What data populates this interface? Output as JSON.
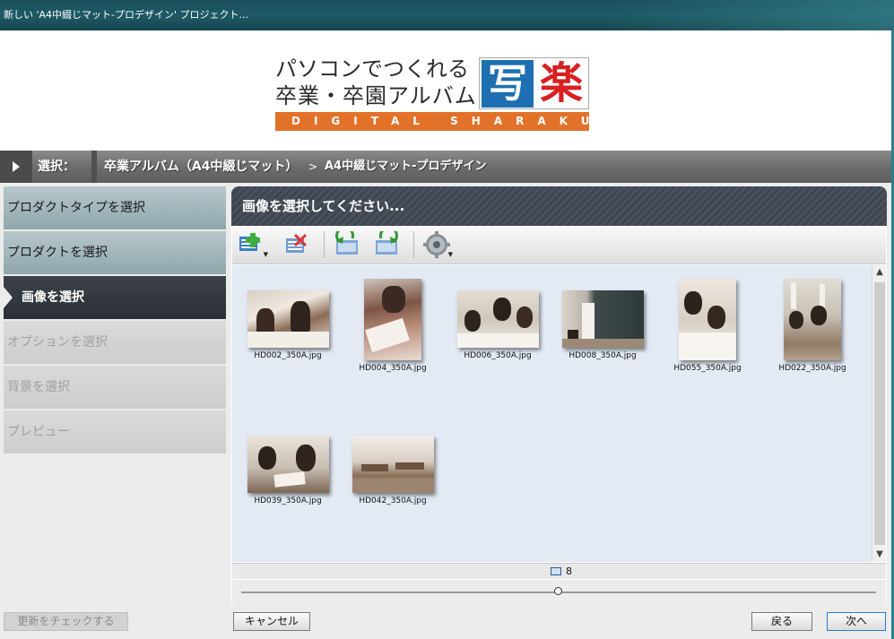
{
  "window": {
    "title": "新しい 'A4中綴じマット-プロデザイン' プロジェクト..."
  },
  "logo": {
    "line1": "パソコンでつくれる",
    "line2": "卒業・卒園アルバム",
    "stripe": "DIGITAL SHARAKU",
    "mark_left": "写",
    "mark_right": "楽"
  },
  "breadcrumb": {
    "label": "選択：",
    "item1": "卒業アルバム（A4中綴じマット）",
    "separator": ">",
    "item2": "A4中綴じマット-プロデザイン"
  },
  "steps": [
    {
      "label": "プロダクトタイプを選択",
      "state": "done"
    },
    {
      "label": "プロダクトを選択",
      "state": "done"
    },
    {
      "label": "画像を選択",
      "state": "current"
    },
    {
      "label": "オプションを選択",
      "state": "todo"
    },
    {
      "label": "背景を選択",
      "state": "todo"
    },
    {
      "label": "プレビュー",
      "state": "todo"
    }
  ],
  "panel": {
    "title": "画像を選択してください..."
  },
  "toolbar": {
    "buttons": [
      {
        "icon": "add-images-icon"
      },
      {
        "icon": "remove-image-icon"
      },
      {
        "icon": "rotate-left-icon"
      },
      {
        "icon": "rotate-right-icon"
      },
      {
        "icon": "settings-icon"
      }
    ]
  },
  "images": [
    {
      "name": "HD002_350A.jpg"
    },
    {
      "name": "HD004_350A.jpg"
    },
    {
      "name": "HD006_350A.jpg"
    },
    {
      "name": "HD008_350A.jpg"
    },
    {
      "name": "HD055_350A.jpg"
    },
    {
      "name": "HD022_350A.jpg"
    },
    {
      "name": "HD039_350A.jpg"
    },
    {
      "name": "HD042_350A.jpg"
    }
  ],
  "status": {
    "image_count": "8"
  },
  "zoom_slider": {
    "value": 0.5
  },
  "buttons": {
    "check_update": "更新をチェックする",
    "cancel": "キャンセル",
    "back": "戻る",
    "next": "次へ"
  },
  "colors": {
    "titlebar": "#1d5a66",
    "logo_orange": "#e2722a",
    "logo_blue": "#1d6fb1",
    "logo_red": "#d92020",
    "panel_header": "#3f4550",
    "grid_bg": "#e3eaf4"
  }
}
